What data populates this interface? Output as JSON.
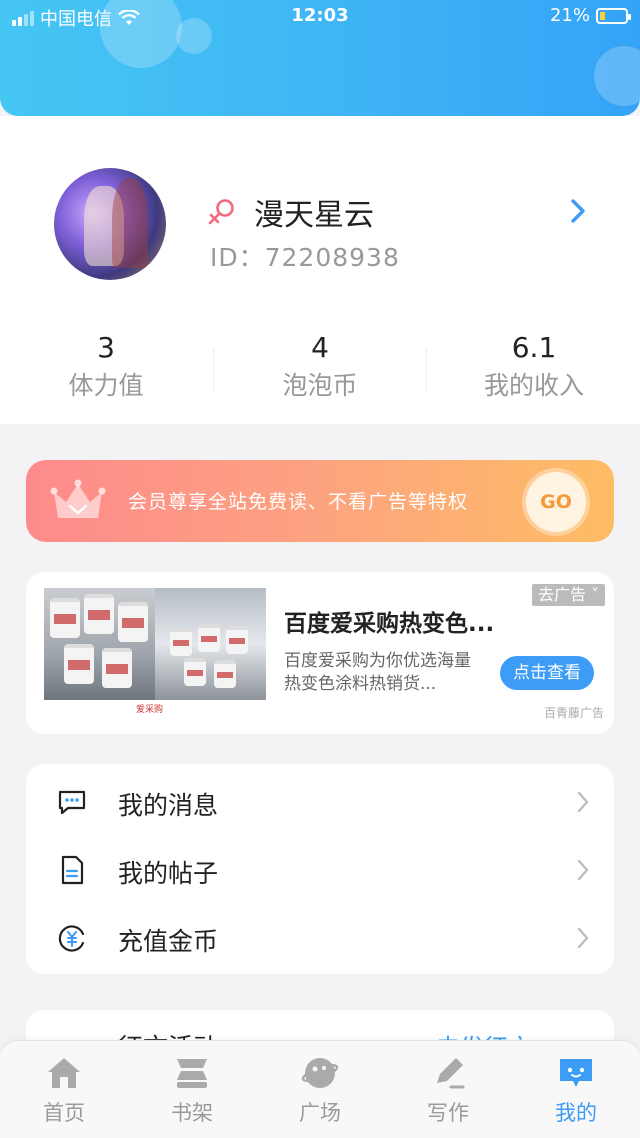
{
  "status_bar": {
    "carrier": "中国电信",
    "time": "12:03",
    "battery": "21%",
    "battery_level": 0.21
  },
  "profile": {
    "name": "漫天星云",
    "id_text": "ID：72208938",
    "stats": [
      {
        "value": "3",
        "label": "体力值"
      },
      {
        "value": "4",
        "label": "泡泡币"
      },
      {
        "value": "6.1",
        "label": "我的收入"
      }
    ]
  },
  "vip_banner": {
    "text": "会员尊享全站免费读、不看广告等特权",
    "button": "GO"
  },
  "ad": {
    "title": "百度爱采购热变色...",
    "description": "百度爱采购为你优选海量热变色涂料热销货...",
    "cta": "点击查看",
    "close": "去广告",
    "source": "百青藤广告",
    "image_logo": "爱采购"
  },
  "menu": {
    "items": [
      {
        "label": "我的消息"
      },
      {
        "label": "我的帖子"
      },
      {
        "label": "充值金币"
      }
    ]
  },
  "partial_card": {
    "label": "征文活动",
    "link": "去发征文"
  },
  "tabs": [
    {
      "label": "首页",
      "icon": "home-icon"
    },
    {
      "label": "书架",
      "icon": "bookshelf-icon"
    },
    {
      "label": "广场",
      "icon": "plaza-icon"
    },
    {
      "label": "写作",
      "icon": "pen-icon"
    },
    {
      "label": "我的",
      "icon": "profile-icon",
      "active": true
    }
  ],
  "colors": {
    "accent": "#3d9cf5",
    "header_start": "#45c6f3",
    "header_end": "#34a3f7",
    "vip_start": "#fd8a8c",
    "vip_end": "#fdbd64"
  }
}
